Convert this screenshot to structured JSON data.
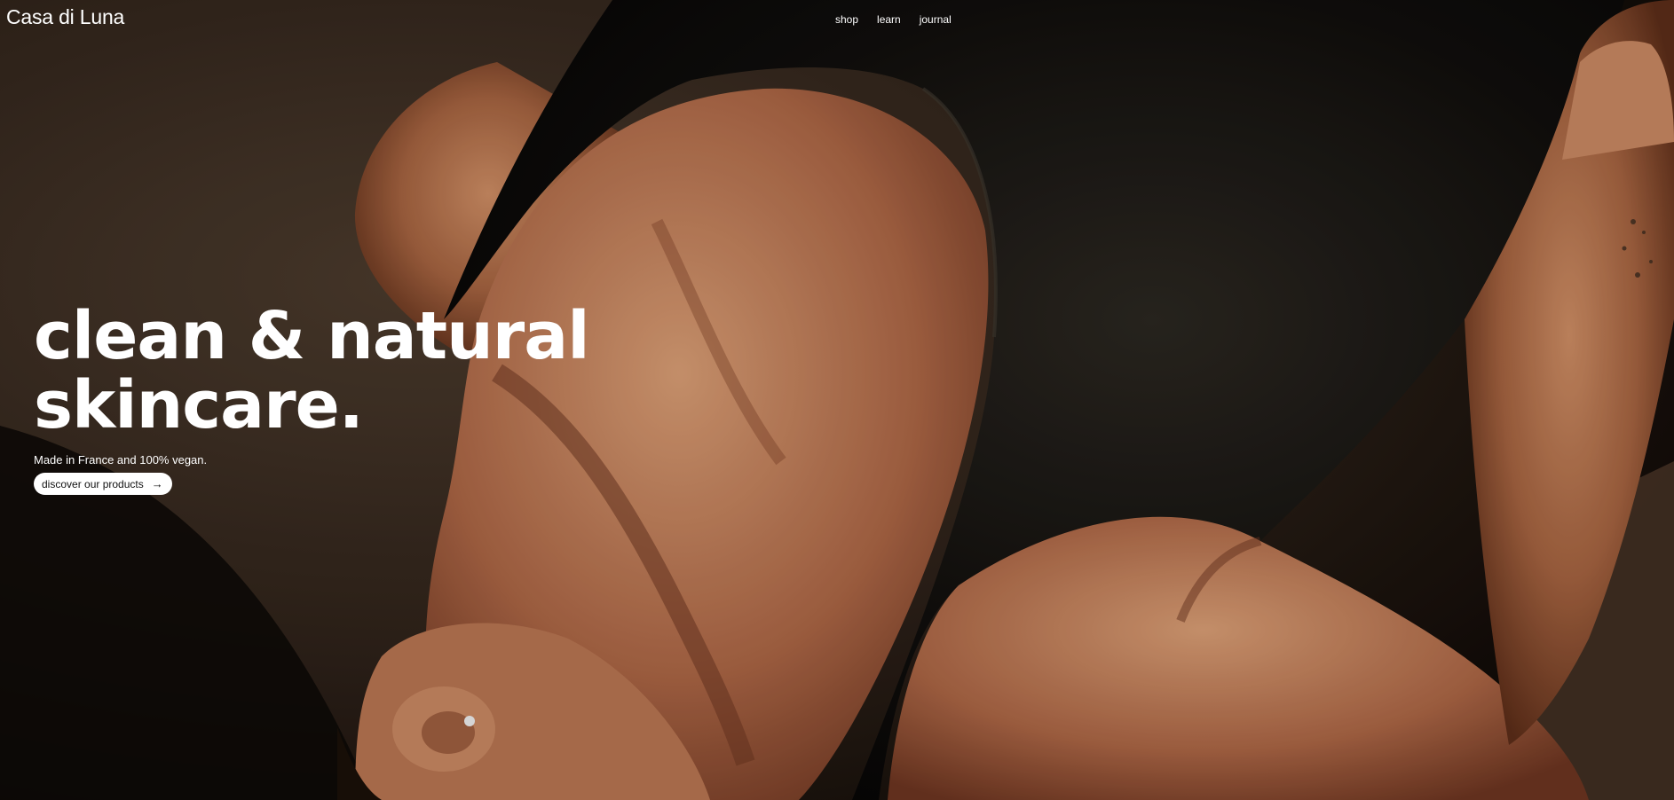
{
  "brand": {
    "logo": "Casa di Luna"
  },
  "nav": {
    "items": [
      {
        "label": "shop"
      },
      {
        "label": "learn"
      },
      {
        "label": "journal"
      }
    ]
  },
  "hero": {
    "headline_line1": "clean & natural",
    "headline_line2": "skincare.",
    "subtitle": "Made in France and 100% vegan.",
    "cta_label": "discover our products",
    "cta_icon": "arrow-right-icon",
    "background": "photo-woman-black-swimsuit-on-sand"
  },
  "colors": {
    "text": "#ffffff",
    "button_bg": "#ffffff",
    "button_text": "#111111",
    "skin": "#b5704a",
    "swimsuit": "#0e0c0a",
    "sand": "#3a2c22"
  }
}
